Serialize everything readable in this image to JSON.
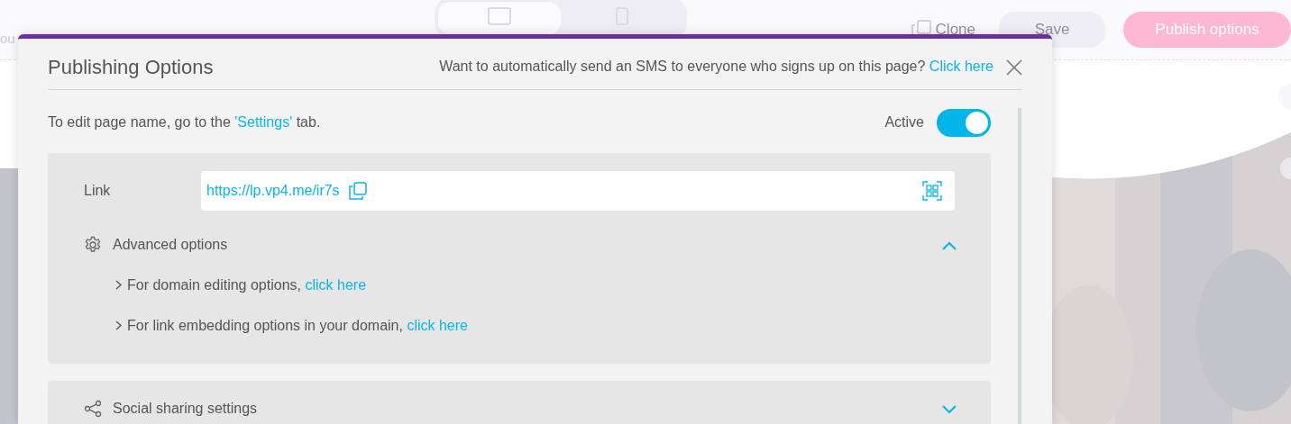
{
  "topbar": {
    "cut_text": "ou",
    "view_toggle": [
      {
        "kind": "desktop",
        "selected": true
      },
      {
        "kind": "mobile",
        "selected": false
      }
    ],
    "clone_label": "Clone",
    "save_label": "Save",
    "publish_label": "Publish options"
  },
  "dialog": {
    "title": "Publishing Options",
    "sms_prompt": "Want to automatically send an SMS to everyone who signs up on this page?",
    "sms_link": "Click here",
    "page_name_note": {
      "before": "To edit page name, go to the",
      "link": "'Settings'",
      "after": "tab."
    },
    "active": {
      "label": "Active",
      "on": true
    },
    "link_panel": {
      "label": "Link",
      "url": "https://lp.vp4.me/ir7s",
      "advanced": {
        "label": "Advanced options",
        "expanded": true,
        "items": [
          {
            "text": "For domain editing options,",
            "link": "click here"
          },
          {
            "text": "For link embedding options in your domain,",
            "link": "click here"
          }
        ]
      }
    },
    "sections": [
      {
        "label": "Social sharing settings",
        "expanded": false
      }
    ]
  }
}
